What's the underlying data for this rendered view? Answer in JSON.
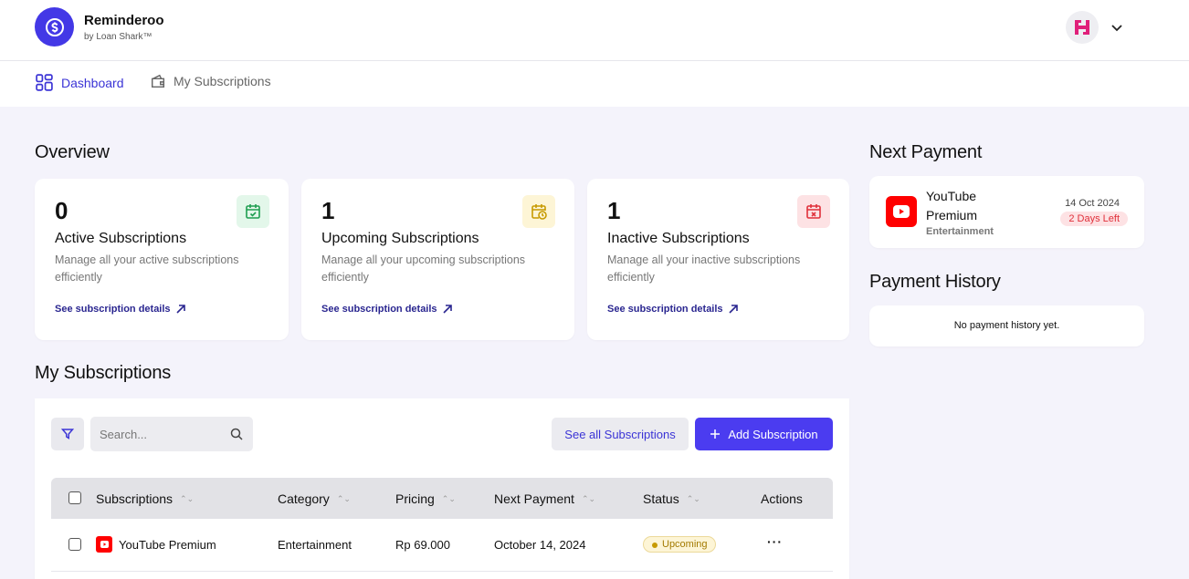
{
  "app": {
    "name": "Reminderoo",
    "tagline": "by Loan Shark™"
  },
  "nav": [
    {
      "label": "Dashboard",
      "icon": "dashboard-grid-icon",
      "active": true
    },
    {
      "label": "My Subscriptions",
      "icon": "wallet-icon",
      "active": false
    }
  ],
  "overview": {
    "title": "Overview",
    "cards": [
      {
        "count": "0",
        "title": "Active Subscriptions",
        "desc": "Manage all your active subscriptions efficiently",
        "link": "See subscription details",
        "icon": "calendar-check-icon",
        "accent": "#1e9e50",
        "accent_bg": "#e3f7ea"
      },
      {
        "count": "1",
        "title": "Upcoming Subscriptions",
        "desc": "Manage all your upcoming subscriptions efficiently",
        "link": "See subscription details",
        "icon": "calendar-clock-icon",
        "accent": "#c79a00",
        "accent_bg": "#fdf5d6"
      },
      {
        "count": "1",
        "title": "Inactive Subscriptions",
        "desc": "Manage all your inactive subscriptions efficiently",
        "link": "See subscription details",
        "icon": "calendar-x-icon",
        "accent": "#e0303a",
        "accent_bg": "#fde2e4"
      }
    ]
  },
  "next_payment": {
    "title": "Next Payment",
    "name_line1": "YouTube",
    "name_line2": "Premium",
    "category": "Entertainment",
    "date": "14 Oct 2024",
    "badge": "2 Days Left"
  },
  "payment_history": {
    "title": "Payment History",
    "empty": "No payment history yet."
  },
  "subscriptions": {
    "title": "My Subscriptions",
    "search_placeholder": "Search...",
    "see_all": "See all Subscriptions",
    "add": "Add Subscription",
    "columns": [
      "Subscriptions",
      "Category",
      "Pricing",
      "Next Payment",
      "Status",
      "Actions"
    ],
    "rows": [
      {
        "name": "YouTube Premium",
        "category": "Entertainment",
        "pricing": "Rp 69.000",
        "next_payment": "October 14, 2024",
        "status": "Upcoming",
        "actions": "···"
      }
    ]
  },
  "colors": {
    "primary": "#4b3cf0",
    "brand": "#4338e6",
    "background": "#f4f3fb"
  }
}
